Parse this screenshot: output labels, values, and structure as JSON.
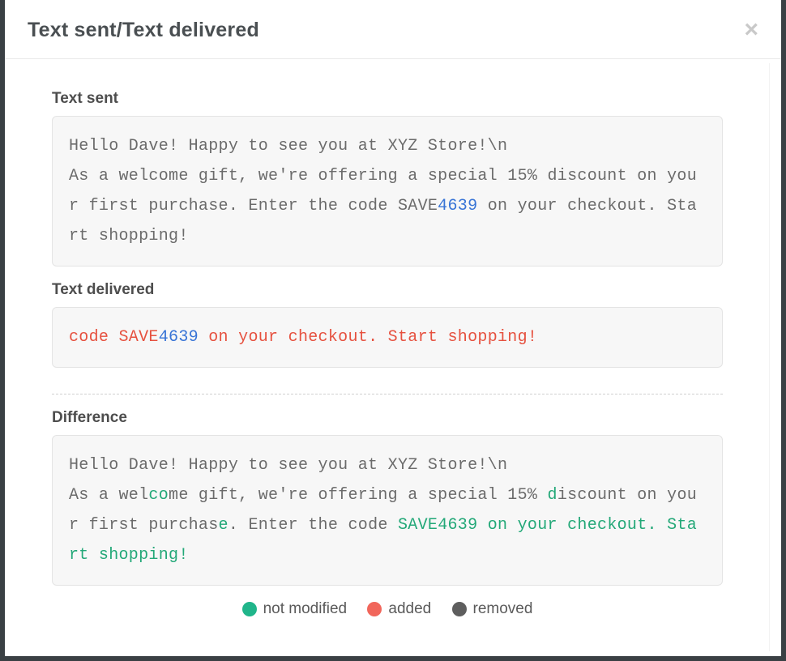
{
  "modal": {
    "title": "Text sent/Text delivered",
    "close_label": "×"
  },
  "labels": {
    "text_sent": "Text sent",
    "text_delivered": "Text delivered",
    "difference": "Difference"
  },
  "text_sent": {
    "pre": "Hello Dave! Happy to see you at XYZ Store!\\n\nAs a welcome gift, we're offering a special 15% discount on your first purchase. Enter the code SAVE",
    "highlight": "4639",
    "post": " on your checkout. Start shopping!"
  },
  "text_delivered": {
    "pre": "code SAVE",
    "highlight": "4639",
    "post": " on your checkout. Start shopping!"
  },
  "difference": {
    "segments": [
      {
        "t": "Hello Dave! Happy to see you at XYZ Store!\\n\nAs a wel",
        "c": "plain"
      },
      {
        "t": "co",
        "c": "green"
      },
      {
        "t": "me gift, we're offering a special 15% ",
        "c": "plain"
      },
      {
        "t": "d",
        "c": "green"
      },
      {
        "t": "iscount on your first purchas",
        "c": "plain"
      },
      {
        "t": "e",
        "c": "green"
      },
      {
        "t": ". Enter the code ",
        "c": "plain"
      },
      {
        "t": "SAVE4639 on your checkout. Start shopping!",
        "c": "green"
      }
    ]
  },
  "legend": {
    "not_modified": "not modified",
    "added": "added",
    "removed": "removed"
  },
  "colors": {
    "green": "#20b58a",
    "red": "#f1665b",
    "grey": "#5e5e5e",
    "blue": "#3874d6"
  }
}
